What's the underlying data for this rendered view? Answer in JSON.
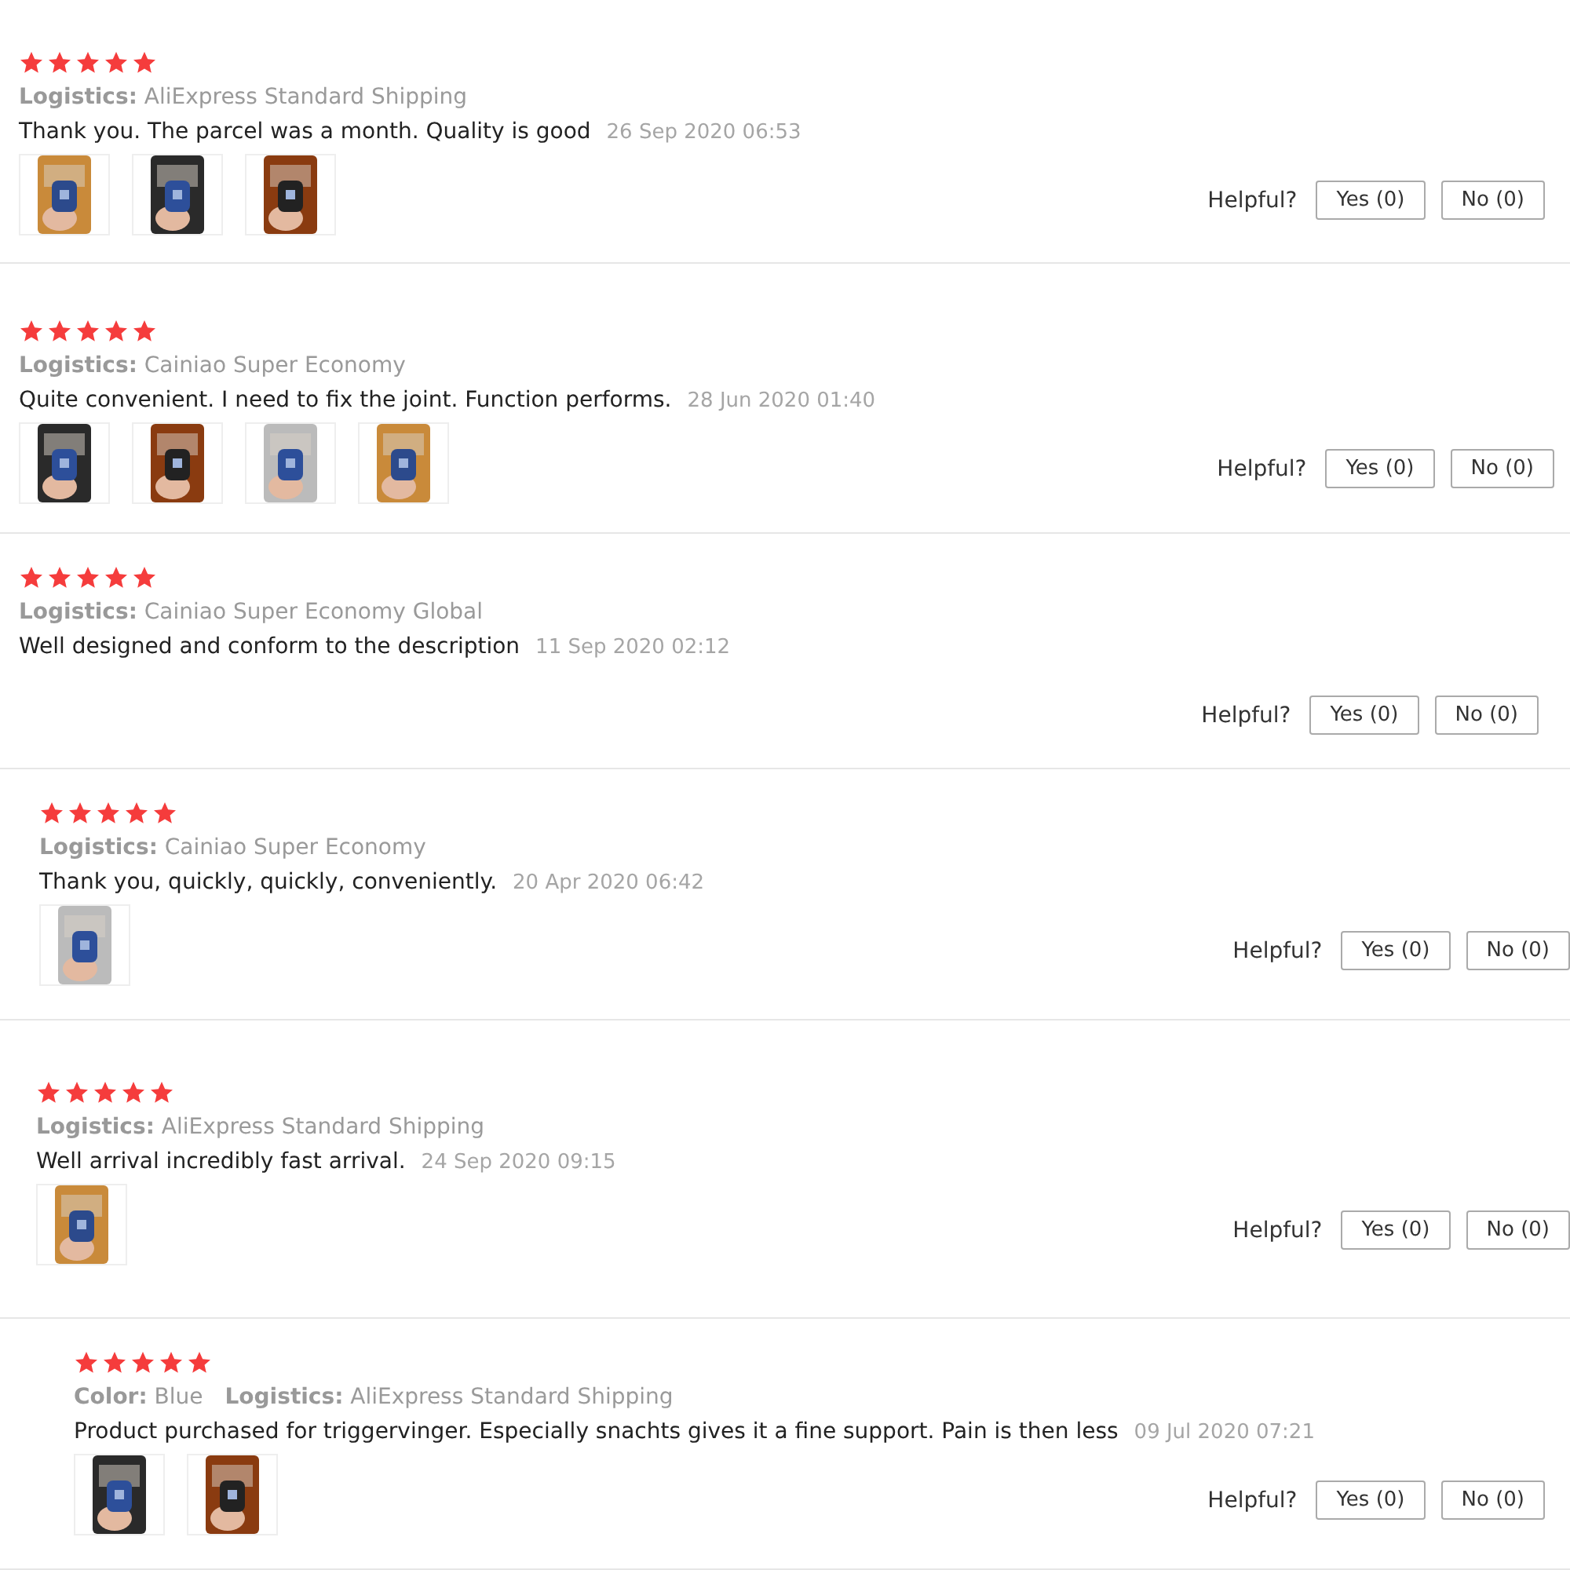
{
  "reviews": [
    {
      "stars": 5,
      "attributes": [
        {
          "label": "Logistics:",
          "value": "AliExpress Standard Shipping"
        }
      ],
      "text": "Thank you. The parcel was a month. Quality is good",
      "date": "26 Sep 2020 06:53",
      "photos": [
        {
          "kind": "picture"
        },
        {
          "kind": "picture"
        },
        {
          "kind": "picture"
        }
      ],
      "helpful": "Helpful?",
      "yes": "Yes (0)",
      "no": "No (0)"
    },
    {
      "stars": 5,
      "attributes": [
        {
          "label": "Logistics:",
          "value": "Cainiao Super Economy"
        }
      ],
      "text": "Quite convenient. I need to fix the joint. Function performs.",
      "date": "28 Jun 2020 01:40",
      "photos": [
        {
          "kind": "picture"
        },
        {
          "kind": "picture"
        },
        {
          "kind": "picture"
        },
        {
          "kind": "picture"
        }
      ],
      "helpful": "Helpful?",
      "yes": "Yes (0)",
      "no": "No (0)"
    },
    {
      "stars": 5,
      "attributes": [
        {
          "label": "Logistics:",
          "value": "Cainiao Super Economy Global"
        }
      ],
      "text": "Well designed and conform to the description",
      "date": "11 Sep 2020 02:12",
      "helpful": "Helpful?",
      "yes": "Yes (0)",
      "no": "No (0)"
    },
    {
      "stars": 5,
      "attributes": [
        {
          "label": "Logistics:",
          "value": "Cainiao Super Economy"
        }
      ],
      "text": "Thank you, quickly, quickly, conveniently.",
      "date": "20 Apr 2020 06:42",
      "photos": [
        {
          "kind": "picture"
        }
      ],
      "helpful": "Helpful?",
      "yes": "Yes (0)",
      "no": "No (0)"
    },
    {
      "stars": 5,
      "attributes": [
        {
          "label": "Logistics:",
          "value": "AliExpress Standard Shipping"
        }
      ],
      "text": "Well arrival incredibly fast arrival.",
      "date": "24 Sep 2020 09:15",
      "photos": [
        {
          "kind": "picture"
        }
      ],
      "helpful": "Helpful?",
      "yes": "Yes (0)",
      "no": "No (0)"
    },
    {
      "stars": 5,
      "attributes": [
        {
          "label": "Color:",
          "value": "Blue"
        },
        {
          "label": "Logistics:",
          "value": "AliExpress Standard Shipping"
        }
      ],
      "text": "Product purchased for triggervinger. Especially snachts gives it a fine support. Pain is then less",
      "date": "09 Jul 2020 07:21",
      "photos": [
        {
          "kind": "picture"
        },
        {
          "kind": "picture"
        }
      ],
      "helpful": "Helpful?",
      "yes": "Yes (0)",
      "no": "No (0)"
    }
  ]
}
